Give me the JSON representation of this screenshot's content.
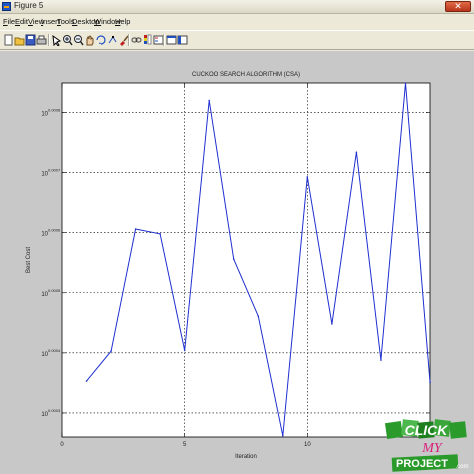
{
  "window": {
    "title": "Figure 5",
    "close_glyph": "✕"
  },
  "menu": [
    {
      "label": "File",
      "key": "F",
      "rest": "ile"
    },
    {
      "label": "Edit",
      "key": "E",
      "rest": "dit"
    },
    {
      "label": "View",
      "key": "V",
      "rest": "iew"
    },
    {
      "label": "Insert",
      "key": "I",
      "rest": "nsert"
    },
    {
      "label": "Tools",
      "key": "T",
      "rest": "ools"
    },
    {
      "label": "Desktop",
      "key": "D",
      "rest": "esktop"
    },
    {
      "label": "Window",
      "key": "W",
      "rest": "indow"
    },
    {
      "label": "Help",
      "key": "H",
      "rest": "elp"
    }
  ],
  "toolbar": {
    "icons": [
      "new-figure-icon",
      "open-file-icon",
      "save-icon",
      "print-icon",
      "edit-plot-icon",
      "zoom-in-icon",
      "zoom-out-icon",
      "pan-icon",
      "rotate-3d-icon",
      "data-cursor-icon",
      "brush-icon",
      "link-icon",
      "colorbar-icon",
      "legend-icon",
      "hide-plot-tools-icon",
      "show-plot-tools-icon"
    ]
  },
  "chart_data": {
    "type": "line",
    "title": "CUCKOO SEARCH ALGORITHM (CSA)",
    "xlabel": "Iteration",
    "ylabel": "Best Cost",
    "xlim": [
      0,
      15
    ],
    "xticks": [
      0,
      5,
      10
    ],
    "yscale": "log",
    "yticks": [
      {
        "base": "10",
        "exp": "0.0008"
      },
      {
        "base": "10",
        "exp": "0.0007"
      },
      {
        "base": "10",
        "exp": "0.0006"
      },
      {
        "base": "10",
        "exp": "0.0005"
      },
      {
        "base": "10",
        "exp": "0.0004"
      },
      {
        "base": "10",
        "exp": "0.0003"
      }
    ],
    "ylim_exp": [
      0.00026,
      0.000849
    ],
    "grid": true,
    "color": "#1f2fd0",
    "x": [
      1,
      2,
      3,
      4,
      5,
      6,
      7,
      8,
      9,
      10,
      11,
      12,
      13,
      14,
      15
    ],
    "y_exp": [
      0.000353,
      0.000403,
      0.000606,
      0.000598,
      0.000404,
      0.00082,
      0.000556,
      0.000461,
      0.000262,
      0.000693,
      0.000448,
      0.000734,
      0.000388,
      0.000849,
      0.000351
    ]
  },
  "watermark": {
    "line1": "CLICK",
    "line2": "MY",
    "line3": "PROJECT",
    "suffix": ".com"
  }
}
